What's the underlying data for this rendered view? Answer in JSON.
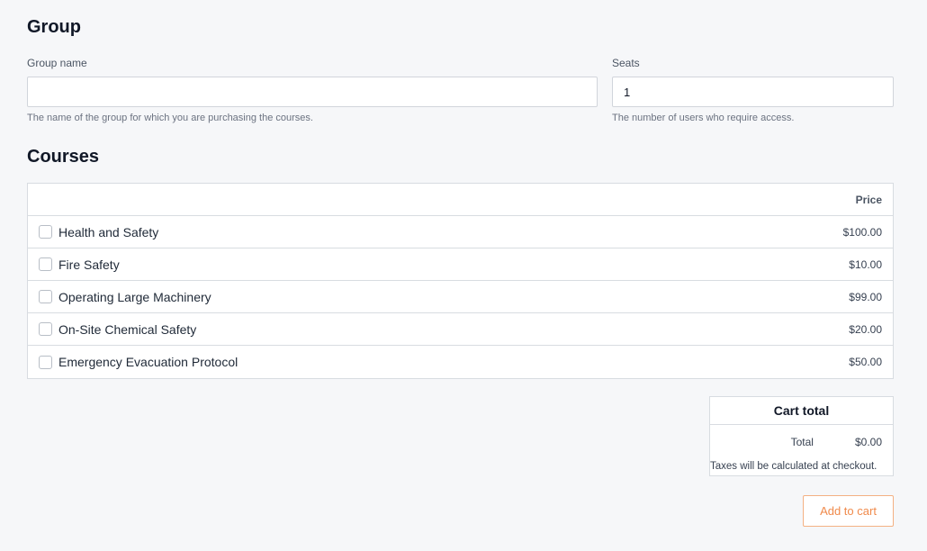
{
  "group": {
    "heading": "Group",
    "name_label": "Group name",
    "name_value": "",
    "name_help": "The name of the group for which you are purchasing the courses.",
    "seats_label": "Seats",
    "seats_value": "1",
    "seats_help": "The number of users who require access."
  },
  "courses": {
    "heading": "Courses",
    "price_header": "Price",
    "items": [
      {
        "name": "Health and Safety",
        "price": "$100.00",
        "checked": false
      },
      {
        "name": "Fire Safety",
        "price": "$10.00",
        "checked": false
      },
      {
        "name": "Operating Large Machinery",
        "price": "$99.00",
        "checked": false
      },
      {
        "name": "On-Site Chemical Safety",
        "price": "$20.00",
        "checked": false
      },
      {
        "name": "Emergency Evacuation Protocol",
        "price": "$50.00",
        "checked": false
      }
    ]
  },
  "cart": {
    "title": "Cart total",
    "total_label": "Total",
    "total_value": "$0.00",
    "note": "Taxes will be calculated at checkout."
  },
  "actions": {
    "add_to_cart": "Add to cart"
  },
  "colors": {
    "accent": "#f08a4b",
    "accent_border": "#f4b183"
  }
}
